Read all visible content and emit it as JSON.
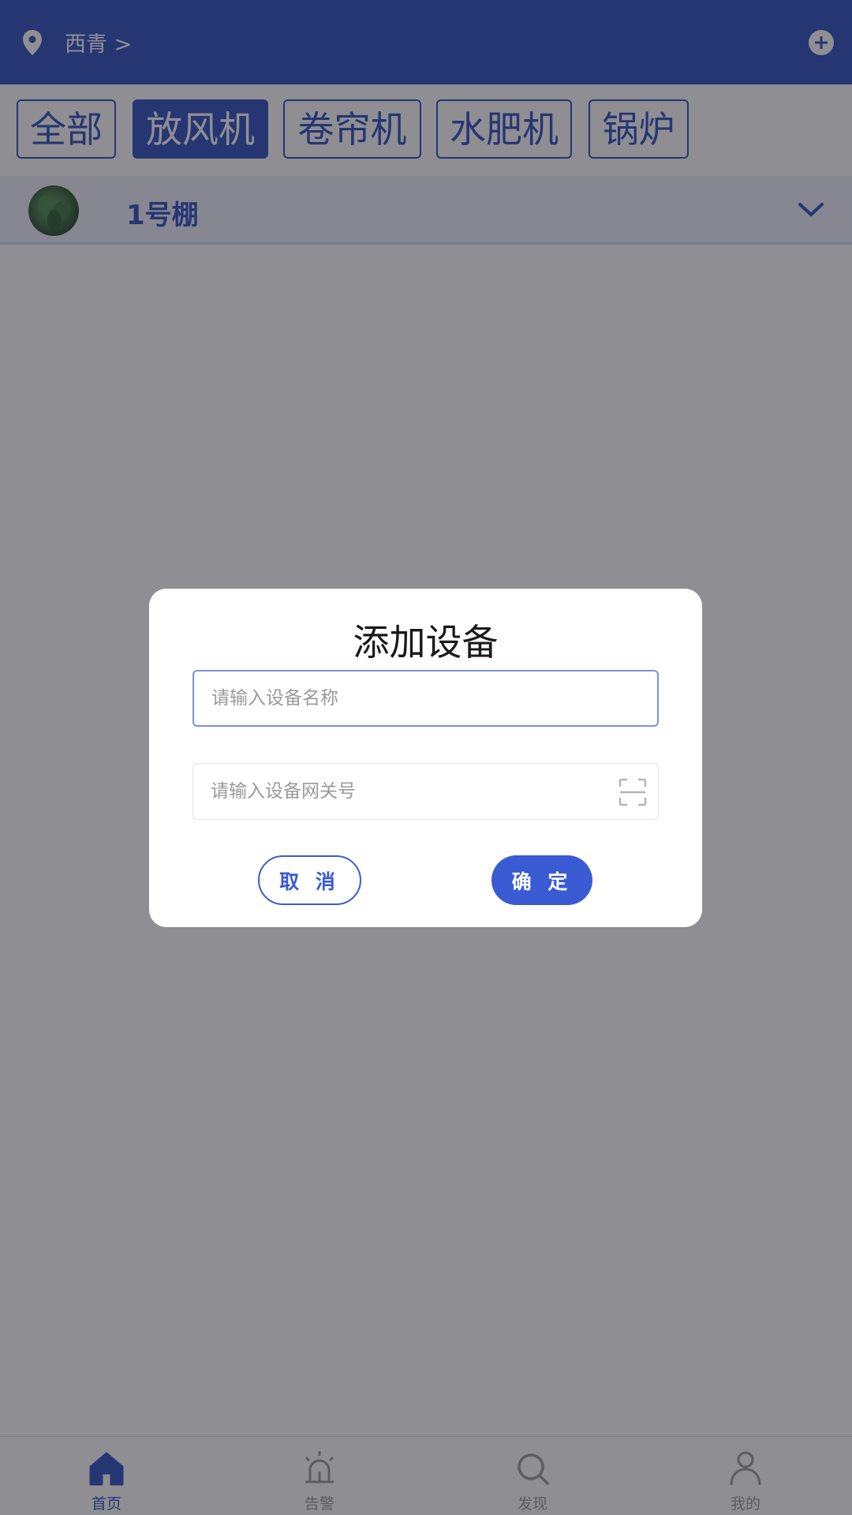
{
  "header": {
    "location": "西青 >",
    "location_icon": "location-pin-icon",
    "add_icon": "plus-circle-icon"
  },
  "tabs": [
    {
      "label": "全部",
      "active": false
    },
    {
      "label": "放风机",
      "active": true
    },
    {
      "label": "卷帘机",
      "active": false
    },
    {
      "label": "水肥机",
      "active": false
    },
    {
      "label": "锅炉",
      "active": false
    }
  ],
  "greenhouse": {
    "name": "1号棚",
    "expand_icon": "chevron-down-icon"
  },
  "dialog": {
    "title": "添加设备",
    "name_placeholder": "请输入设备名称",
    "gateway_placeholder": "请输入设备网关号",
    "scan_icon": "scan-icon",
    "cancel_label": "取 消",
    "confirm_label": "确 定"
  },
  "bottom_nav": [
    {
      "label": "首页",
      "icon": "home-icon",
      "active": true
    },
    {
      "label": "告警",
      "icon": "alarm-icon",
      "active": false
    },
    {
      "label": "发现",
      "icon": "search-icon",
      "active": false
    },
    {
      "label": "我的",
      "icon": "user-icon",
      "active": false
    }
  ],
  "colors": {
    "primary": "#2f4fbf",
    "button": "#3a5bd4",
    "overlay": "rgba(30,30,40,0.5)"
  }
}
